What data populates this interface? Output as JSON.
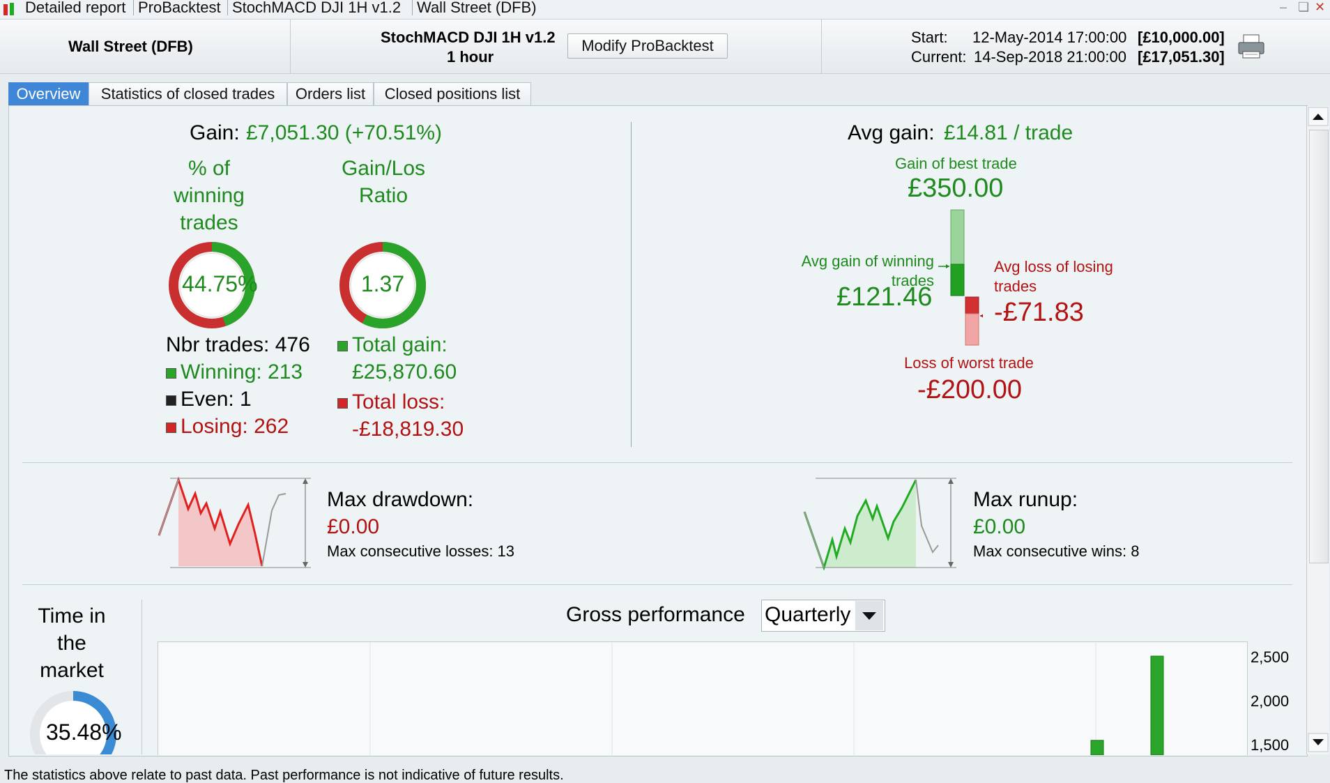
{
  "window": {
    "title_parts": [
      "Detailed report",
      "ProBacktest",
      "StochMACD DJI 1H v1.2",
      "Wall Street (DFB)"
    ]
  },
  "header": {
    "instrument": "Wall Street (DFB)",
    "strategy_name": "StochMACD DJI 1H v1.2",
    "timeframe": "1 hour",
    "modify_button": "Modify ProBacktest",
    "start_label": "Start:",
    "start_value": "12-May-2014 17:00:00",
    "start_capital": "[£10,000.00]",
    "current_label": "Current:",
    "current_value": "14-Sep-2018 21:00:00",
    "current_capital": "[£17,051.30]"
  },
  "tabs": [
    {
      "label": "Overview",
      "active": true
    },
    {
      "label": "Statistics of closed trades",
      "active": false
    },
    {
      "label": "Orders list",
      "active": false
    },
    {
      "label": "Closed positions list",
      "active": false
    }
  ],
  "overview": {
    "gain_label": "Gain:",
    "gain_value": "£7,051.30 (+70.51%)",
    "winning_pct_title": [
      "% of",
      "winning",
      "trades"
    ],
    "winning_pct_value": "44.75%",
    "winning_pct_fraction": 0.4475,
    "ratio_title": [
      "Gain/Los",
      "Ratio"
    ],
    "ratio_value": "1.37",
    "ratio_fraction": 0.578,
    "nbr_trades_label": "Nbr trades: 476",
    "winning_label": "Winning: 213",
    "even_label": "Even: 1",
    "losing_label": "Losing: 262",
    "total_gain_label": "Total gain:",
    "total_gain_value": "£25,870.60",
    "total_loss_label": "Total loss:",
    "total_loss_value": "-£18,819.30",
    "avg_gain_label": "Avg gain:",
    "avg_gain_value": "£14.81 / trade",
    "best_trade_label": "Gain of best trade",
    "best_trade_value": "£350.00",
    "avg_win_label": [
      "Avg gain of winning",
      "trades"
    ],
    "avg_win_value": "£121.46",
    "avg_loss_label": [
      "Avg loss of losing",
      "trades"
    ],
    "avg_loss_value": "-£71.83",
    "worst_trade_label": "Loss of worst trade",
    "worst_trade_value": "-£200.00",
    "max_drawdown_label": "Max drawdown:",
    "max_drawdown_value": "£0.00",
    "max_consec_losses": "Max consecutive losses: 13",
    "max_runup_label": "Max runup:",
    "max_runup_value": "£0.00",
    "max_consec_wins": "Max consecutive wins: 8",
    "time_in_market_title": [
      "Time in",
      "the",
      "market"
    ],
    "time_in_market_value": "35.48%",
    "time_in_market_fraction": 0.3548,
    "gross_perf_label": "Gross performance",
    "period_select": "Quarterly"
  },
  "colors": {
    "green": "#1e8a1e",
    "red": "#b31212",
    "tab_active": "#3f86d6",
    "blue_ring": "#3a8ad4"
  },
  "chart_data": {
    "type": "bar",
    "title": "Gross performance",
    "y_ticks": [
      "2,500",
      "2,000",
      "1,500"
    ],
    "ylim_visible": [
      1500,
      2500
    ],
    "series": [
      {
        "values": [
          2500,
          1510
        ]
      }
    ],
    "bar_colors": "#2aa52a"
  },
  "footer": {
    "disclaimer": "The statistics above relate to past data. Past performance is not indicative of future results."
  }
}
